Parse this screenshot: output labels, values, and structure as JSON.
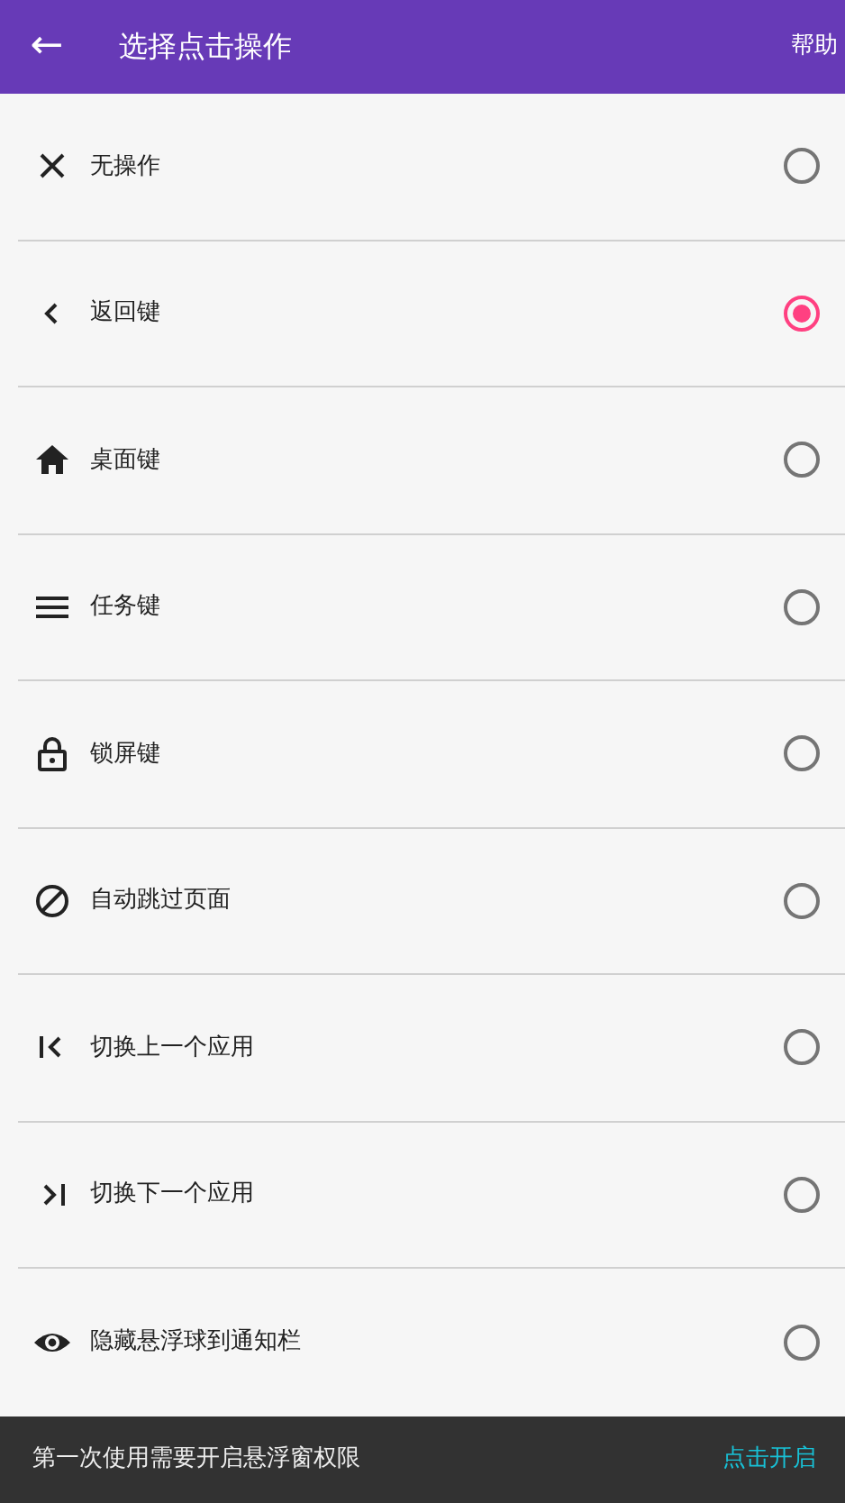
{
  "app_bar": {
    "back": "←",
    "title": "选择点击操作",
    "action": "帮助"
  },
  "options": [
    {
      "label": "无操作",
      "selected": false
    },
    {
      "label": "返回键",
      "selected": true
    },
    {
      "label": "桌面键",
      "selected": false
    },
    {
      "label": "任务键",
      "selected": false
    },
    {
      "label": "锁屏键",
      "selected": false
    },
    {
      "label": "自动跳过页面",
      "selected": false
    },
    {
      "label": "切换上一个应用",
      "selected": false
    },
    {
      "label": "切换下一个应用",
      "selected": false
    },
    {
      "label": "隐藏悬浮球到通知栏",
      "selected": false
    }
  ],
  "snackbar": {
    "message": "第一次使用需要开启悬浮窗权限",
    "action": "点击开启"
  }
}
